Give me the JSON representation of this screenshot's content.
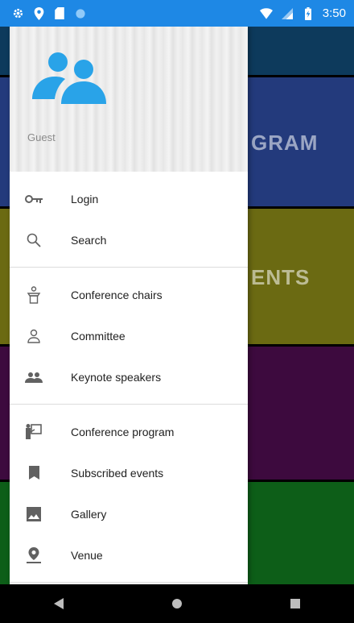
{
  "status_bar": {
    "time": "3:50",
    "icons_left": [
      "gear-icon",
      "location-icon",
      "sd-card-icon",
      "circle-icon"
    ],
    "icons_right": [
      "wifi-icon",
      "signal-icon",
      "battery-icon"
    ],
    "color": "#1e88e5"
  },
  "background_tiles": [
    {
      "label": "",
      "color": "#0d3a5c"
    },
    {
      "label": "GRAM",
      "color": "#233a7c"
    },
    {
      "label": "ENTS",
      "color": "#6b6a12"
    },
    {
      "label": "",
      "color": "#3d0a3e"
    },
    {
      "label": "",
      "color": "#0d5e18"
    }
  ],
  "drawer": {
    "header": {
      "user_name": "Guest",
      "avatar_icon": "people-icon",
      "avatar_color": "#29a3e8"
    },
    "groups": [
      [
        {
          "label": "Login",
          "icon": "key-icon"
        },
        {
          "label": "Search",
          "icon": "search-icon"
        }
      ],
      [
        {
          "label": "Conference chairs",
          "icon": "podium-icon"
        },
        {
          "label": "Committee",
          "icon": "person-outline-icon"
        },
        {
          "label": "Keynote speakers",
          "icon": "group-icon"
        }
      ],
      [
        {
          "label": "Conference program",
          "icon": "presentation-icon"
        },
        {
          "label": "Subscribed events",
          "icon": "bookmark-icon"
        },
        {
          "label": "Gallery",
          "icon": "image-icon"
        },
        {
          "label": "Venue",
          "icon": "map-pin-icon"
        }
      ]
    ]
  },
  "nav_bar": {
    "buttons": [
      "back-icon",
      "home-icon",
      "recents-icon"
    ]
  }
}
